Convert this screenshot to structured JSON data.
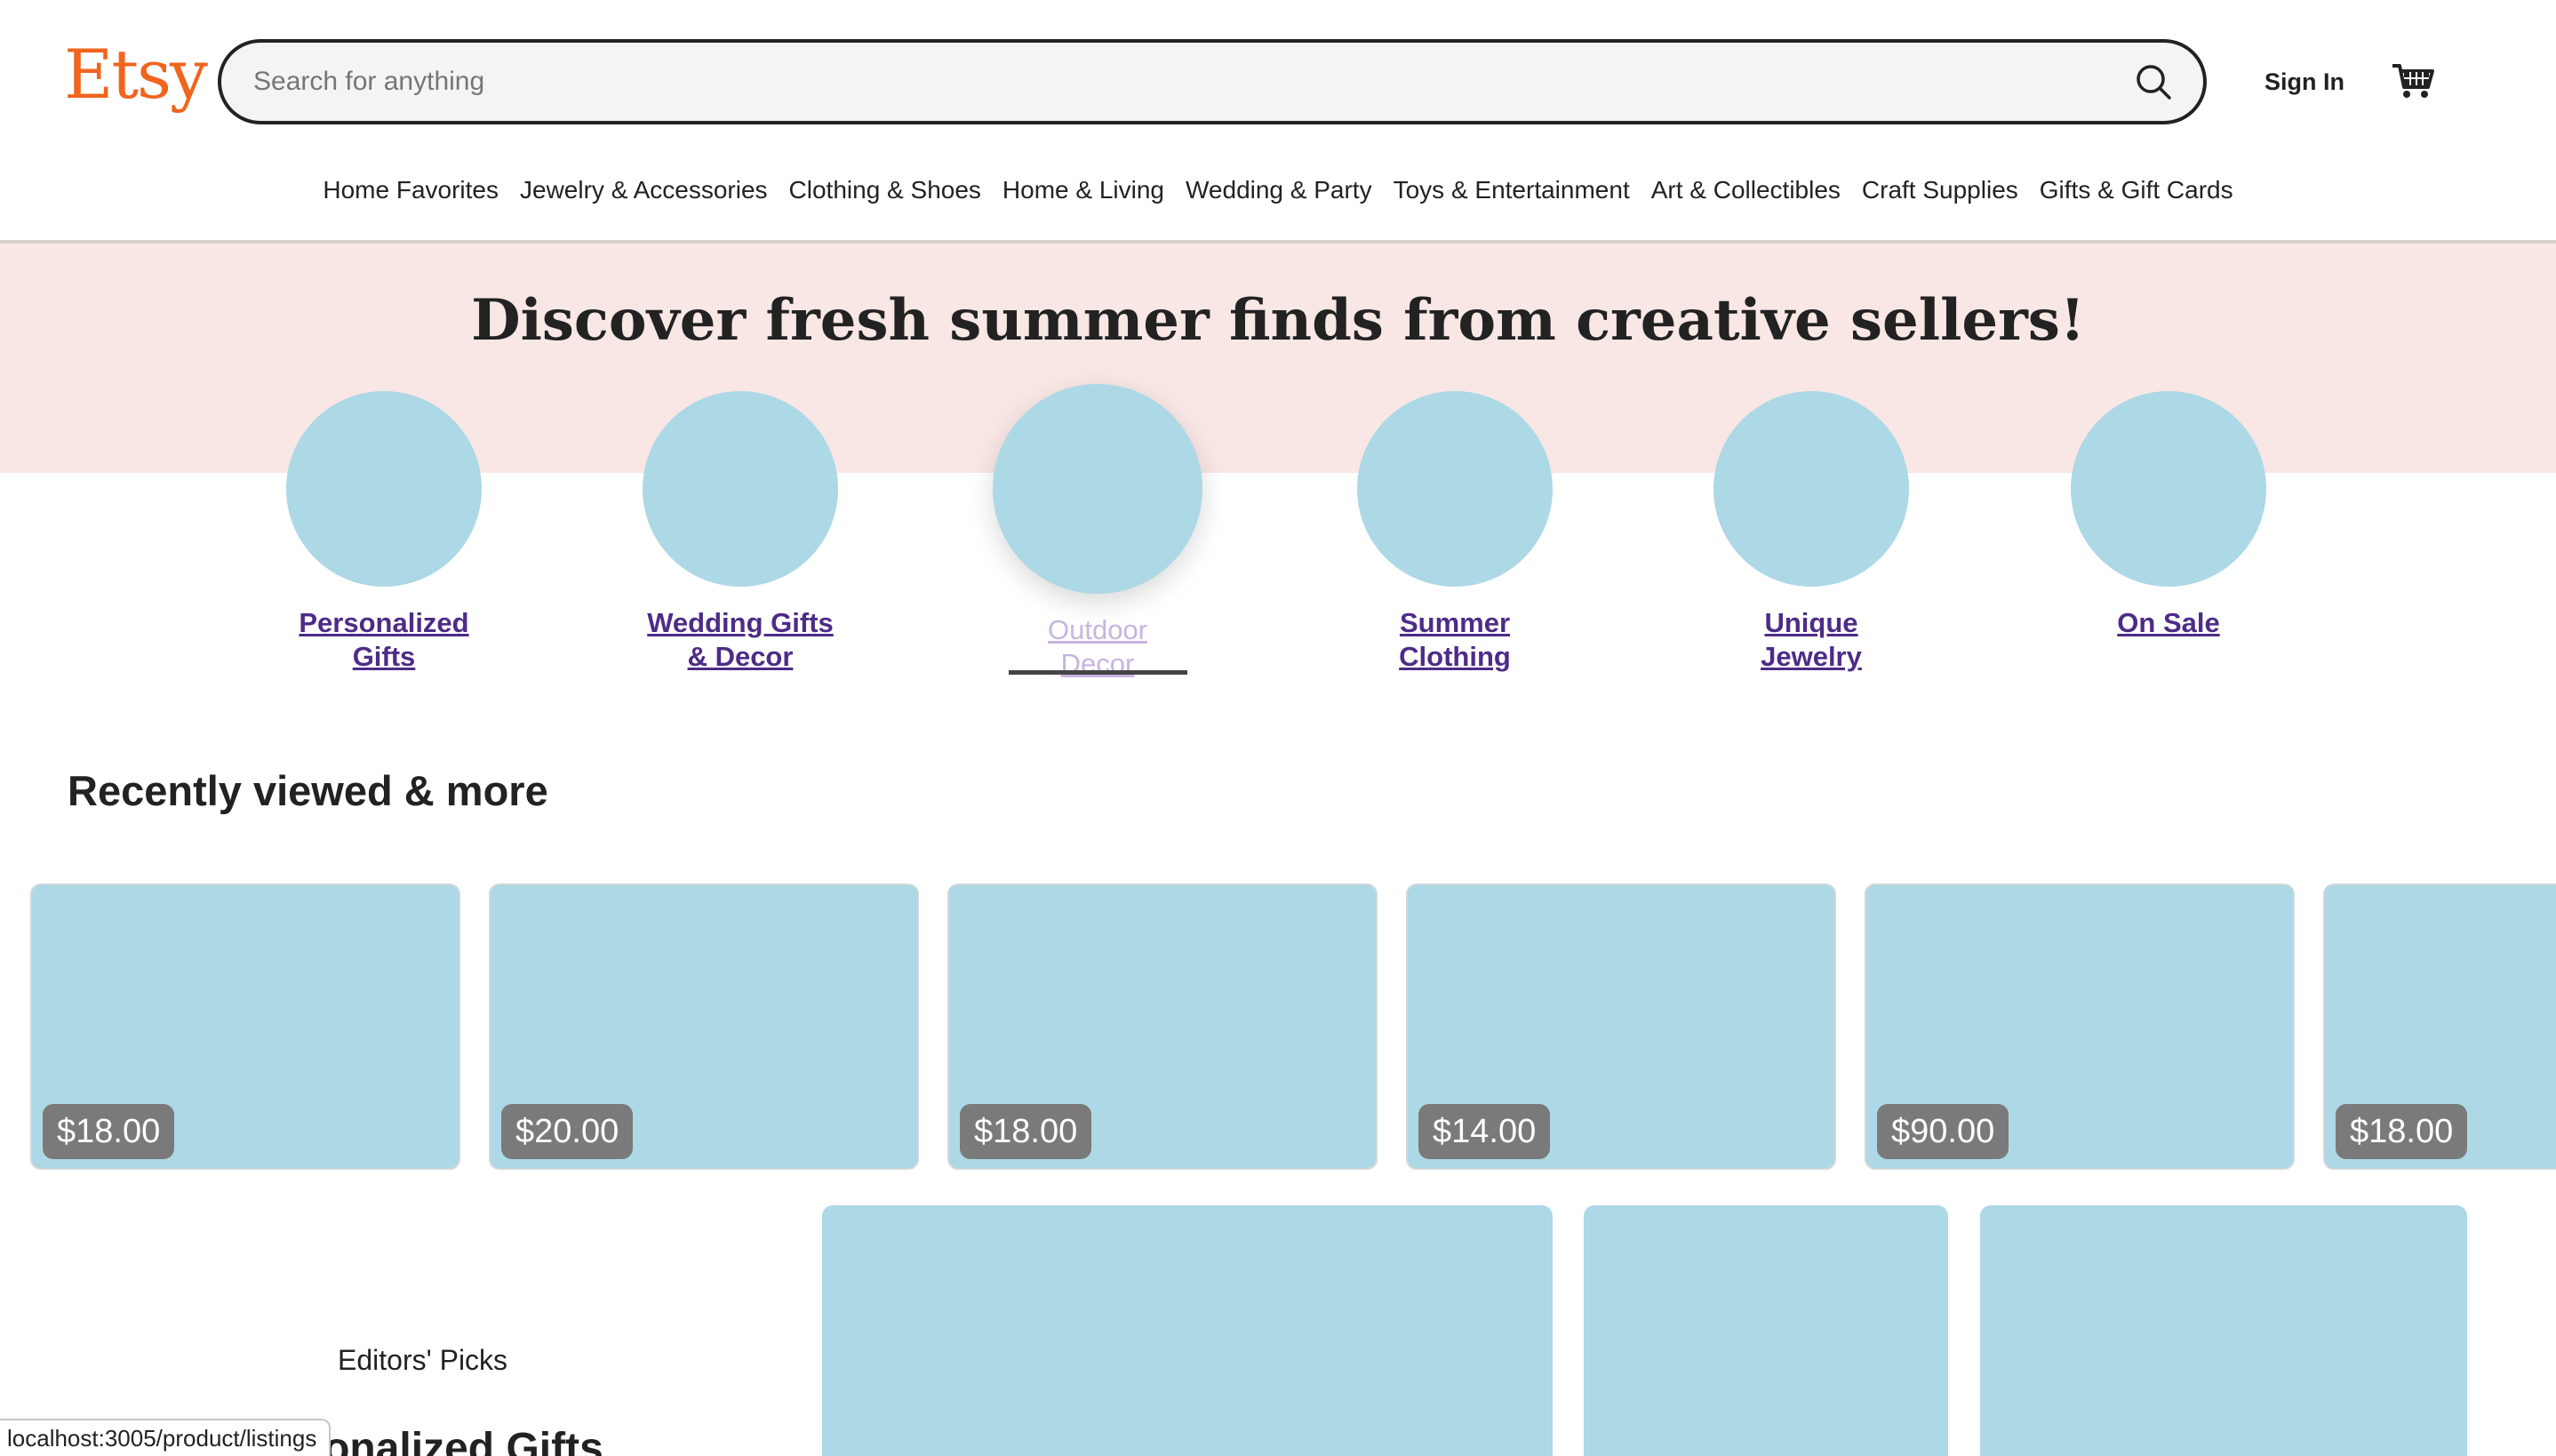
{
  "header": {
    "logo": "Etsy",
    "search_placeholder": "Search for anything",
    "search_value": "",
    "sign_in": "Sign In",
    "icons": {
      "search": "search-icon",
      "cart": "cart-icon"
    }
  },
  "categories": [
    "Home Favorites",
    "Jewelry & Accessories",
    "Clothing & Shoes",
    "Home & Living",
    "Wedding & Party",
    "Toys & Entertainment",
    "Art & Collectibles",
    "Craft Supplies",
    "Gifts & Gift Cards"
  ],
  "hero": {
    "title": "Discover fresh summer finds from creative sellers!",
    "background_color": "#f8e7e5",
    "circles": [
      {
        "line1": "Personalized",
        "line2": "Gifts"
      },
      {
        "line1": "Wedding Gifts",
        "line2": "& Decor"
      },
      {
        "line1": "Outdoor",
        "line2": "Decor"
      },
      {
        "line1": "Summer",
        "line2": "Clothing"
      },
      {
        "line1": "Unique",
        "line2": "Jewelry"
      },
      {
        "line1": "On Sale",
        "line2": ""
      }
    ]
  },
  "recently_viewed": {
    "title": "Recently viewed & more",
    "items": [
      {
        "price": "$18.00"
      },
      {
        "price": "$20.00"
      },
      {
        "price": "$18.00"
      },
      {
        "price": "$14.00"
      },
      {
        "price": "$90.00"
      },
      {
        "price": "$18.00"
      }
    ]
  },
  "editors_picks": {
    "label": "Editors' Picks",
    "heading": "Personalized Gifts"
  },
  "status_bar": {
    "url": "localhost:3005/product/listings"
  },
  "colors": {
    "brand": "#f1641e",
    "link": "#4d2c87",
    "placeholder_image": "#add8e6",
    "price_badge": "#7a7a7a"
  }
}
